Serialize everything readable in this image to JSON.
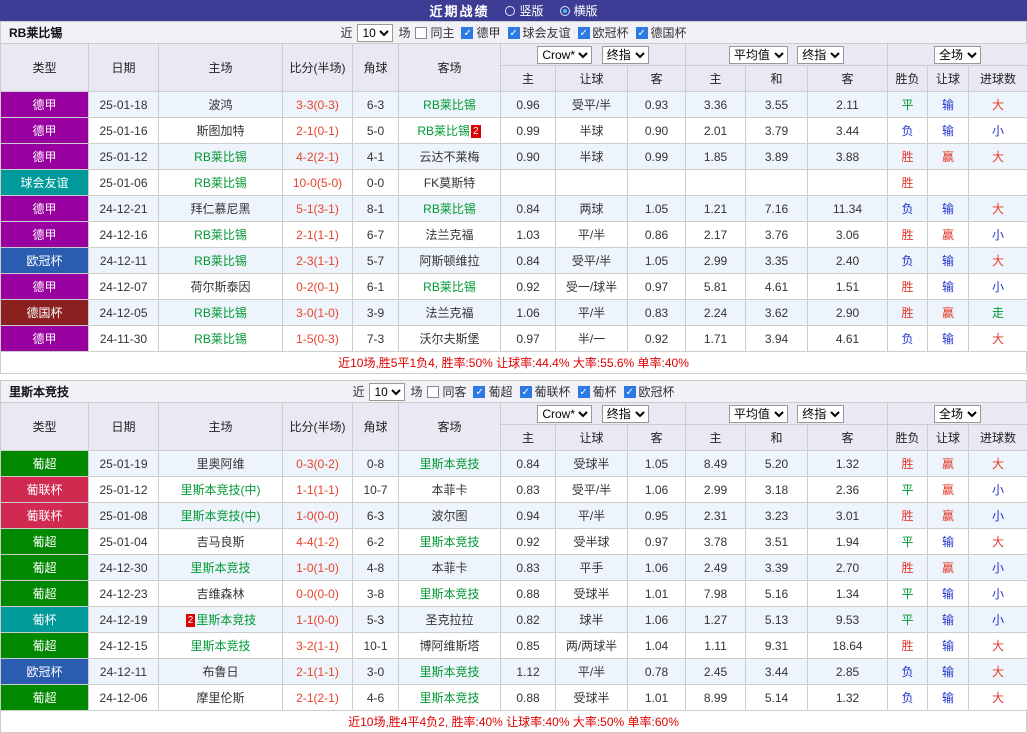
{
  "topbar": {
    "title": "近期战绩",
    "layout_options": [
      {
        "label": "竖版",
        "selected": false
      },
      {
        "label": "横版",
        "selected": true
      }
    ]
  },
  "table_columns": {
    "type": "类型",
    "date": "日期",
    "home": "主场",
    "score": "比分(半场)",
    "corner": "角球",
    "away": "客场",
    "odds_home": "主",
    "handicap": "让球",
    "odds_away": "客",
    "avg_home": "主",
    "avg_draw": "和",
    "avg_away": "客",
    "result_wdl": "胜负",
    "result_handicap": "让球",
    "result_goals": "进球数"
  },
  "selects": {
    "source": "Crow*",
    "final1": "终指",
    "average": "平均值",
    "final2": "终指",
    "scope": "全场"
  },
  "colors": {
    "topbar_bg": "#3d3d96",
    "radio_selected": "#35c5ff",
    "score_text": "#e8432a",
    "team_highlight": "#009933",
    "red_card_bg": "#dd0000",
    "summary_text": "#e00000",
    "header_bg": "#e9e9f4",
    "section_bar_bg": "#f1f1f7",
    "row_alt_bg": "#eef4fb",
    "league": {
      "德甲": "#9900a0",
      "球会友谊": "#009a9a",
      "欧冠杯": "#2a5db0",
      "德国杯": "#8a2020",
      "葡超": "#008800",
      "葡联杯": "#d02a50",
      "葡杯": "#009a9a"
    },
    "result": {
      "胜": "#e4392a",
      "平": "#009933",
      "负": "#2233cc",
      "赢": "#e4392a",
      "走": "#009933",
      "输": "#2233cc",
      "大": "#e4392a",
      "小": "#2233cc"
    }
  },
  "sections": [
    {
      "team": "RB莱比锡",
      "filter": {
        "prefix": "近",
        "count": "10",
        "suffix": "场",
        "venue_label": "同主",
        "venue_checked": false,
        "leagues": [
          {
            "label": "德甲",
            "checked": true
          },
          {
            "label": "球会友谊",
            "checked": true
          },
          {
            "label": "欧冠杯",
            "checked": true
          },
          {
            "label": "德国杯",
            "checked": true
          }
        ]
      },
      "rows": [
        {
          "league": "德甲",
          "date": "25-01-18",
          "home": "波鸿",
          "home_hl": false,
          "away": "RB莱比锡",
          "away_hl": true,
          "score": "3-3(0-3)",
          "corner": "6-3",
          "odds": [
            "0.96",
            "受平/半",
            "0.93",
            "3.36",
            "3.55",
            "2.11"
          ],
          "results": [
            "平",
            "输",
            "大"
          ]
        },
        {
          "league": "德甲",
          "date": "25-01-16",
          "home": "斯图加特",
          "home_hl": false,
          "away": "RB莱比锡",
          "away_hl": true,
          "away_card": {
            "text": "2",
            "pos": "after"
          },
          "score": "2-1(0-1)",
          "corner": "5-0",
          "odds": [
            "0.99",
            "半球",
            "0.90",
            "2.01",
            "3.79",
            "3.44"
          ],
          "results": [
            "负",
            "输",
            "小"
          ]
        },
        {
          "league": "德甲",
          "date": "25-01-12",
          "home": "RB莱比锡",
          "home_hl": true,
          "away": "云达不莱梅",
          "away_hl": false,
          "score": "4-2(2-1)",
          "corner": "4-1",
          "odds": [
            "0.90",
            "半球",
            "0.99",
            "1.85",
            "3.89",
            "3.88"
          ],
          "results": [
            "胜",
            "赢",
            "大"
          ]
        },
        {
          "league": "球会友谊",
          "date": "25-01-06",
          "home": "RB莱比锡",
          "home_hl": true,
          "away": "FK莫斯特",
          "away_hl": false,
          "score": "10-0(5-0)",
          "corner": "0-0",
          "odds": [
            "",
            "",
            "",
            "",
            "",
            ""
          ],
          "results": [
            "胜",
            "",
            ""
          ]
        },
        {
          "league": "德甲",
          "date": "24-12-21",
          "home": "拜仁慕尼黑",
          "home_hl": false,
          "away": "RB莱比锡",
          "away_hl": true,
          "score": "5-1(3-1)",
          "corner": "8-1",
          "odds": [
            "0.84",
            "两球",
            "1.05",
            "1.21",
            "7.16",
            "11.34"
          ],
          "results": [
            "负",
            "输",
            "大"
          ]
        },
        {
          "league": "德甲",
          "date": "24-12-16",
          "home": "RB莱比锡",
          "home_hl": true,
          "away": "法兰克福",
          "away_hl": false,
          "score": "2-1(1-1)",
          "corner": "6-7",
          "odds": [
            "1.03",
            "平/半",
            "0.86",
            "2.17",
            "3.76",
            "3.06"
          ],
          "results": [
            "胜",
            "赢",
            "小"
          ]
        },
        {
          "league": "欧冠杯",
          "date": "24-12-11",
          "home": "RB莱比锡",
          "home_hl": true,
          "away": "阿斯顿维拉",
          "away_hl": false,
          "score": "2-3(1-1)",
          "corner": "5-7",
          "odds": [
            "0.84",
            "受平/半",
            "1.05",
            "2.99",
            "3.35",
            "2.40"
          ],
          "results": [
            "负",
            "输",
            "大"
          ]
        },
        {
          "league": "德甲",
          "date": "24-12-07",
          "home": "荷尔斯泰因",
          "home_hl": false,
          "away": "RB莱比锡",
          "away_hl": true,
          "score": "0-2(0-1)",
          "corner": "6-1",
          "odds": [
            "0.92",
            "受一/球半",
            "0.97",
            "5.81",
            "4.61",
            "1.51"
          ],
          "results": [
            "胜",
            "输",
            "小"
          ]
        },
        {
          "league": "德国杯",
          "date": "24-12-05",
          "home": "RB莱比锡",
          "home_hl": true,
          "away": "法兰克福",
          "away_hl": false,
          "score": "3-0(1-0)",
          "corner": "3-9",
          "odds": [
            "1.06",
            "平/半",
            "0.83",
            "2.24",
            "3.62",
            "2.90"
          ],
          "results": [
            "胜",
            "赢",
            "走"
          ]
        },
        {
          "league": "德甲",
          "date": "24-11-30",
          "home": "RB莱比锡",
          "home_hl": true,
          "away": "沃尔夫斯堡",
          "away_hl": false,
          "score": "1-5(0-3)",
          "corner": "7-3",
          "odds": [
            "0.97",
            "半/一",
            "0.92",
            "1.71",
            "3.94",
            "4.61"
          ],
          "results": [
            "负",
            "输",
            "大"
          ]
        }
      ],
      "summary": "近10场,胜5平1负4, 胜率:50% 让球率:44.4% 大率:55.6% 单率:40%"
    },
    {
      "team": "里斯本竞技",
      "filter": {
        "prefix": "近",
        "count": "10",
        "suffix": "场",
        "venue_label": "同客",
        "venue_checked": false,
        "leagues": [
          {
            "label": "葡超",
            "checked": true
          },
          {
            "label": "葡联杯",
            "checked": true
          },
          {
            "label": "葡杯",
            "checked": true
          },
          {
            "label": "欧冠杯",
            "checked": true
          }
        ]
      },
      "rows": [
        {
          "league": "葡超",
          "date": "25-01-19",
          "home": "里奥阿维",
          "home_hl": false,
          "away": "里斯本竞技",
          "away_hl": true,
          "score": "0-3(0-2)",
          "corner": "0-8",
          "odds": [
            "0.84",
            "受球半",
            "1.05",
            "8.49",
            "5.20",
            "1.32"
          ],
          "results": [
            "胜",
            "赢",
            "大"
          ]
        },
        {
          "league": "葡联杯",
          "date": "25-01-12",
          "home": "里斯本竞技(中)",
          "home_hl": true,
          "away": "本菲卡",
          "away_hl": false,
          "score": "1-1(1-1)",
          "corner": "10-7",
          "odds": [
            "0.83",
            "受平/半",
            "1.06",
            "2.99",
            "3.18",
            "2.36"
          ],
          "results": [
            "平",
            "赢",
            "小"
          ]
        },
        {
          "league": "葡联杯",
          "date": "25-01-08",
          "home": "里斯本竞技(中)",
          "home_hl": true,
          "away": "波尔图",
          "away_hl": false,
          "score": "1-0(0-0)",
          "corner": "6-3",
          "odds": [
            "0.94",
            "平/半",
            "0.95",
            "2.31",
            "3.23",
            "3.01"
          ],
          "results": [
            "胜",
            "赢",
            "小"
          ]
        },
        {
          "league": "葡超",
          "date": "25-01-04",
          "home": "吉马良斯",
          "home_hl": false,
          "away": "里斯本竞技",
          "away_hl": true,
          "score": "4-4(1-2)",
          "corner": "6-2",
          "odds": [
            "0.92",
            "受半球",
            "0.97",
            "3.78",
            "3.51",
            "1.94"
          ],
          "results": [
            "平",
            "输",
            "大"
          ]
        },
        {
          "league": "葡超",
          "date": "24-12-30",
          "home": "里斯本竞技",
          "home_hl": true,
          "away": "本菲卡",
          "away_hl": false,
          "score": "1-0(1-0)",
          "corner": "4-8",
          "odds": [
            "0.83",
            "平手",
            "1.06",
            "2.49",
            "3.39",
            "2.70"
          ],
          "results": [
            "胜",
            "赢",
            "小"
          ]
        },
        {
          "league": "葡超",
          "date": "24-12-23",
          "home": "吉维森林",
          "home_hl": false,
          "away": "里斯本竞技",
          "away_hl": true,
          "score": "0-0(0-0)",
          "corner": "3-8",
          "odds": [
            "0.88",
            "受球半",
            "1.01",
            "7.98",
            "5.16",
            "1.34"
          ],
          "results": [
            "平",
            "输",
            "小"
          ]
        },
        {
          "league": "葡杯",
          "date": "24-12-19",
          "home": "里斯本竞技",
          "home_hl": true,
          "home_card": {
            "text": "2",
            "pos": "before"
          },
          "away": "圣克拉拉",
          "away_hl": false,
          "score": "1-1(0-0)",
          "corner": "5-3",
          "odds": [
            "0.82",
            "球半",
            "1.06",
            "1.27",
            "5.13",
            "9.53"
          ],
          "results": [
            "平",
            "输",
            "小"
          ]
        },
        {
          "league": "葡超",
          "date": "24-12-15",
          "home": "里斯本竞技",
          "home_hl": true,
          "away": "博阿维斯塔",
          "away_hl": false,
          "score": "3-2(1-1)",
          "corner": "10-1",
          "odds": [
            "0.85",
            "两/两球半",
            "1.04",
            "1.11",
            "9.31",
            "18.64"
          ],
          "results": [
            "胜",
            "输",
            "大"
          ]
        },
        {
          "league": "欧冠杯",
          "date": "24-12-11",
          "home": "布鲁日",
          "home_hl": false,
          "away": "里斯本竞技",
          "away_hl": true,
          "score": "2-1(1-1)",
          "corner": "3-0",
          "odds": [
            "1.12",
            "平/半",
            "0.78",
            "2.45",
            "3.44",
            "2.85"
          ],
          "results": [
            "负",
            "输",
            "大"
          ]
        },
        {
          "league": "葡超",
          "date": "24-12-06",
          "home": "摩里伦斯",
          "home_hl": false,
          "away": "里斯本竞技",
          "away_hl": true,
          "score": "2-1(2-1)",
          "corner": "4-6",
          "odds": [
            "0.88",
            "受球半",
            "1.01",
            "8.99",
            "5.14",
            "1.32"
          ],
          "results": [
            "负",
            "输",
            "大"
          ]
        }
      ],
      "summary": "近10场,胜4平4负2, 胜率:40% 让球率:40% 大率:50% 单率:60%"
    }
  ]
}
